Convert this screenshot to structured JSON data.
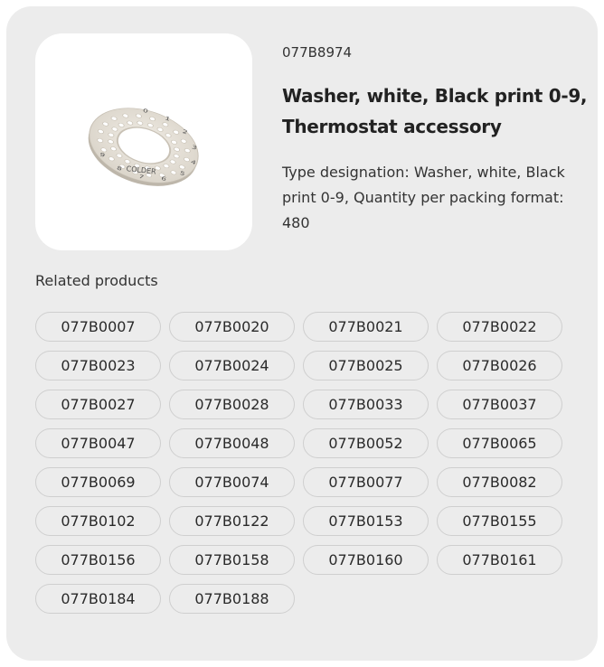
{
  "product": {
    "sku": "077B8974",
    "title": "Washer, white, Black print 0-9, Thermostat accessory",
    "description": "Type designation: Washer, white, Black print 0-9, Quantity per packing format: 480",
    "image_alt": "washer-dial-image",
    "dial_labels": [
      "0",
      "1",
      "2",
      "3",
      "4",
      "5",
      "6",
      "7",
      "8",
      "9"
    ],
    "dial_word": "COLDER"
  },
  "related": {
    "title": "Related products",
    "items": [
      "077B0007",
      "077B0020",
      "077B0021",
      "077B0022",
      "077B0023",
      "077B0024",
      "077B0025",
      "077B0026",
      "077B0027",
      "077B0028",
      "077B0033",
      "077B0037",
      "077B0047",
      "077B0048",
      "077B0052",
      "077B0065",
      "077B0069",
      "077B0074",
      "077B0077",
      "077B0082",
      "077B0102",
      "077B0122",
      "077B0153",
      "077B0155",
      "077B0156",
      "077B0158",
      "077B0160",
      "077B0161",
      "077B0184",
      "077B0188"
    ]
  },
  "colors": {
    "card_bg": "#ececec",
    "chip_border": "#cfcfcf",
    "text": "#2a2a2a"
  }
}
